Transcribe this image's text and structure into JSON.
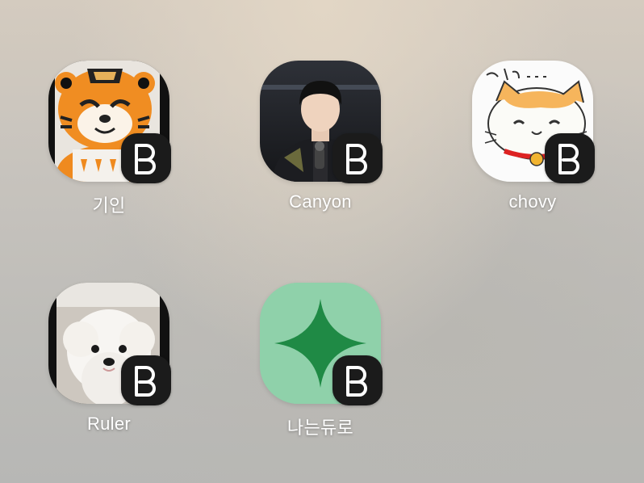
{
  "screen": "home-screen-shortcuts",
  "badge_icon": "bd-app-badge-icon",
  "apps": [
    {
      "label": "기인",
      "icon": "orange-tiger-mascot-photo"
    },
    {
      "label": "Canyon",
      "icon": "person-portrait-photo"
    },
    {
      "label": "chovy",
      "icon": "cartoon-cat-drawing"
    },
    {
      "label": "Ruler",
      "icon": "white-pomeranian-dog-photo"
    },
    {
      "label": "나는듀로",
      "icon": "green-sparkle-star-icon"
    }
  ],
  "colors": {
    "label_text": "#ffffff",
    "badge_bg": "#1b1b1b",
    "sparkle_bg": "#8fd1aa",
    "sparkle_star": "#1f8a45"
  }
}
